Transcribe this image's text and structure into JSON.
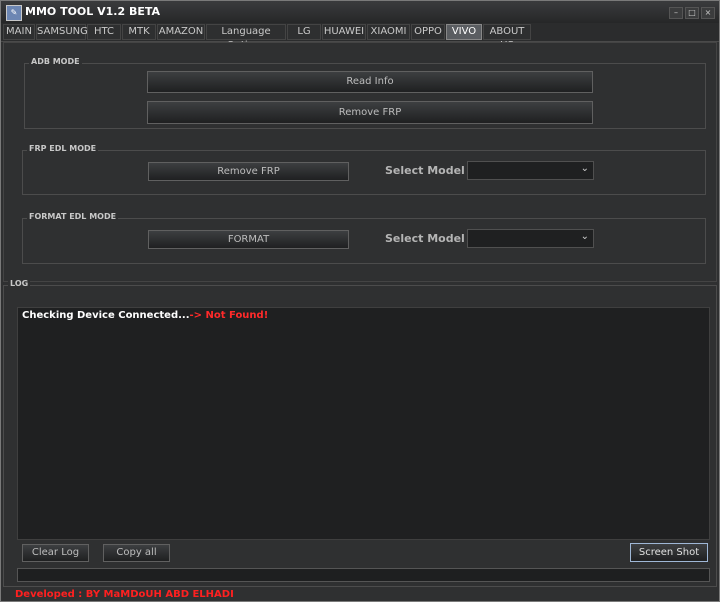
{
  "window": {
    "title": "MMO TOOL V1.2 BETA",
    "min_label": "–",
    "max_label": "□",
    "close_label": "×"
  },
  "tabs": [
    {
      "label": "MAIN"
    },
    {
      "label": "SAMSUNG"
    },
    {
      "label": "HTC"
    },
    {
      "label": "MTK"
    },
    {
      "label": "AMAZON"
    },
    {
      "label": "Language Options"
    },
    {
      "label": "LG"
    },
    {
      "label": "HUAWEI"
    },
    {
      "label": "XIAOMI"
    },
    {
      "label": "OPPO"
    },
    {
      "label": "VIVO",
      "active": true
    },
    {
      "label": "ABOUT US"
    }
  ],
  "adb": {
    "title": "ADB MODE",
    "read_info": "Read Info",
    "remove_frp": "Remove FRP"
  },
  "frp_edl": {
    "title": "FRP EDL MODE",
    "remove_frp": "Remove FRP",
    "select_label": "Select Model :",
    "selected": ""
  },
  "format_edl": {
    "title": "FORMAT EDL MODE",
    "format": "FORMAT",
    "select_label": "Select Model :",
    "selected": ""
  },
  "log": {
    "title": "LOG",
    "message": "Checking Device Connected...",
    "status": "-> Not Found!",
    "clear_label": "Clear Log",
    "copy_label": "Copy all",
    "screenshot_label": "Screen Shot"
  },
  "footer": {
    "text": "Developed : BY  MaMDoUH ABD ELHADI"
  },
  "colors": {
    "status_red": "#ff2a2a",
    "active_tab": "#5a5d61",
    "background": "#2f3031"
  }
}
